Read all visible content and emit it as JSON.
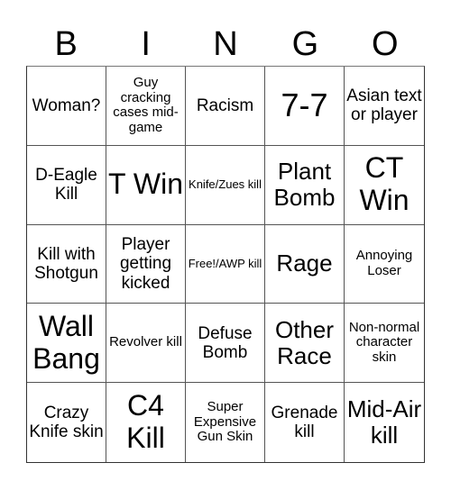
{
  "header": {
    "letters": [
      "B",
      "I",
      "N",
      "G",
      "O"
    ]
  },
  "board": {
    "rows": [
      [
        {
          "text": "Woman?",
          "size": "m"
        },
        {
          "text": "Guy cracking cases mid-game",
          "size": "s"
        },
        {
          "text": "Racism",
          "size": "m"
        },
        {
          "text": "7-7",
          "size": "xxl"
        },
        {
          "text": "Asian text or player",
          "size": "m"
        }
      ],
      [
        {
          "text": "D-Eagle Kill",
          "size": "m"
        },
        {
          "text": "T Win",
          "size": "xl"
        },
        {
          "text": "Knife/Zues kill",
          "size": "xs"
        },
        {
          "text": "Plant Bomb",
          "size": "l"
        },
        {
          "text": "CT Win",
          "size": "xl"
        }
      ],
      [
        {
          "text": "Kill with Shotgun",
          "size": "m"
        },
        {
          "text": "Player getting kicked",
          "size": "m"
        },
        {
          "text": "Free!/AWP kill",
          "size": "xs"
        },
        {
          "text": "Rage",
          "size": "l"
        },
        {
          "text": "Annoying Loser",
          "size": "s"
        }
      ],
      [
        {
          "text": "Wall Bang",
          "size": "xl"
        },
        {
          "text": "Revolver kill",
          "size": "s"
        },
        {
          "text": "Defuse Bomb",
          "size": "m"
        },
        {
          "text": "Other Race",
          "size": "l"
        },
        {
          "text": "Non-normal character skin",
          "size": "s"
        }
      ],
      [
        {
          "text": "Crazy Knife skin",
          "size": "m"
        },
        {
          "text": "C4 Kill",
          "size": "xl"
        },
        {
          "text": "Super Expensive Gun Skin",
          "size": "s"
        },
        {
          "text": "Grenade kill",
          "size": "m"
        },
        {
          "text": "Mid-Air kill",
          "size": "l"
        }
      ]
    ]
  }
}
